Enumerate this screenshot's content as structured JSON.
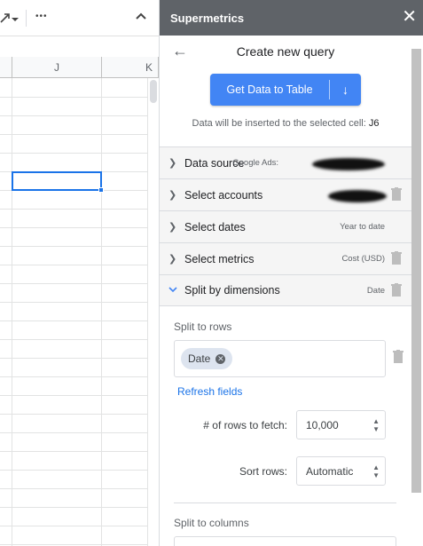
{
  "sheet": {
    "columns": [
      "J",
      "K"
    ]
  },
  "toolbar": {
    "overflow_label": "•••",
    "collapse_label": "⌃"
  },
  "panel": {
    "title": "Supermetrics",
    "close_label": "✕"
  },
  "query": {
    "back_label": "←",
    "title": "Create new query",
    "get_button_label": "Get Data to Table",
    "get_button_arrow": "↓",
    "insert_note": "Data will be inserted to the selected cell:",
    "insert_cell": "J6"
  },
  "rows": [
    {
      "label": "Data source",
      "value": "Google Ads:",
      "expanded": false
    },
    {
      "label": "Select accounts",
      "value": "",
      "expanded": false
    },
    {
      "label": "Select dates",
      "value": "Year to date",
      "expanded": false
    },
    {
      "label": "Select metrics",
      "value": "Cost (USD)",
      "expanded": false
    },
    {
      "label": "Split by dimensions",
      "value": "Date",
      "expanded": true
    }
  ],
  "split": {
    "rows_label": "Split to rows",
    "chip": "Date",
    "refresh_label": "Refresh fields",
    "rows_to_fetch_label": "# of rows to fetch:",
    "rows_to_fetch_value": "10,000",
    "sort_label": "Sort rows:",
    "sort_value": "Automatic",
    "columns_label": "Split to columns"
  },
  "colors": {
    "accent": "#4285f4",
    "header_bg": "#5f6368",
    "selection": "#1a73e8"
  }
}
